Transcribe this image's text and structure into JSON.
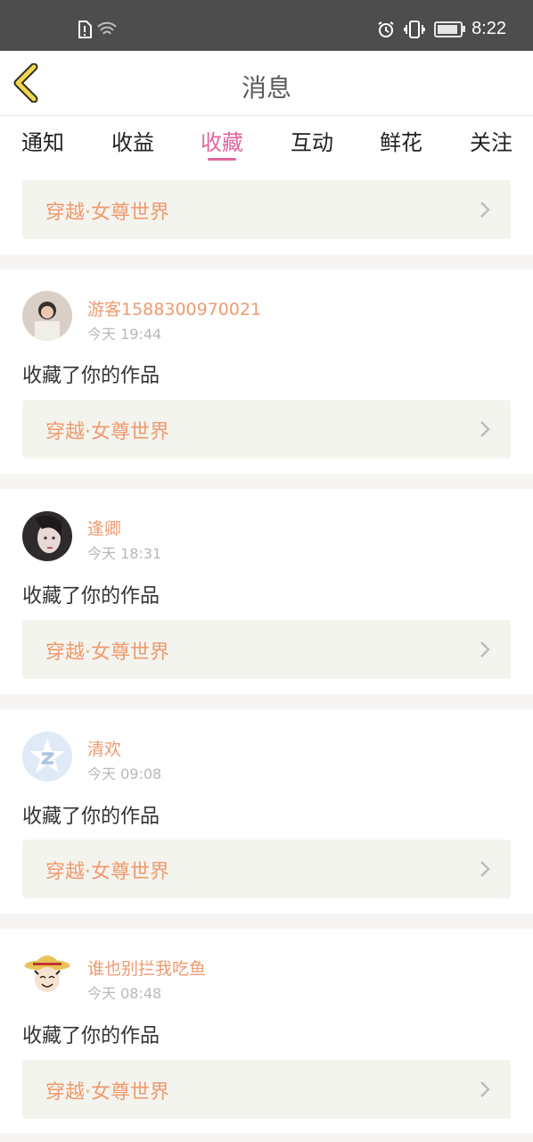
{
  "status_bar": {
    "time": "8:22",
    "icons": [
      "sim-alert-icon",
      "wifi-icon",
      "alarm-icon",
      "vibrate-icon",
      "battery-icon"
    ]
  },
  "header": {
    "title": "消息"
  },
  "tabs": [
    {
      "label": "通知"
    },
    {
      "label": "收益"
    },
    {
      "label": "收藏",
      "active": true
    },
    {
      "label": "互动"
    },
    {
      "label": "鲜花"
    },
    {
      "label": "关注"
    }
  ],
  "top_card": {
    "work_title": "穿越·女尊世界"
  },
  "items": [
    {
      "username": "游客1588300970021",
      "time": "今天 19:44",
      "action": "收藏了你的作品",
      "work_title": "穿越·女尊世界"
    },
    {
      "username": "逢卿",
      "time": "今天 18:31",
      "action": "收藏了你的作品",
      "work_title": "穿越·女尊世界"
    },
    {
      "username": "清欢",
      "time": "今天 09:08",
      "action": "收藏了你的作品",
      "work_title": "穿越·女尊世界"
    },
    {
      "username": "谁也别拦我吃鱼",
      "time": "今天 08:48",
      "action": "收藏了你的作品",
      "work_title": "穿越·女尊世界"
    }
  ],
  "colors": {
    "accent": "#e0669e",
    "username": "#ef9a6f",
    "card_bg": "#f4f4ee",
    "status_bar": "#4d4d4d"
  }
}
